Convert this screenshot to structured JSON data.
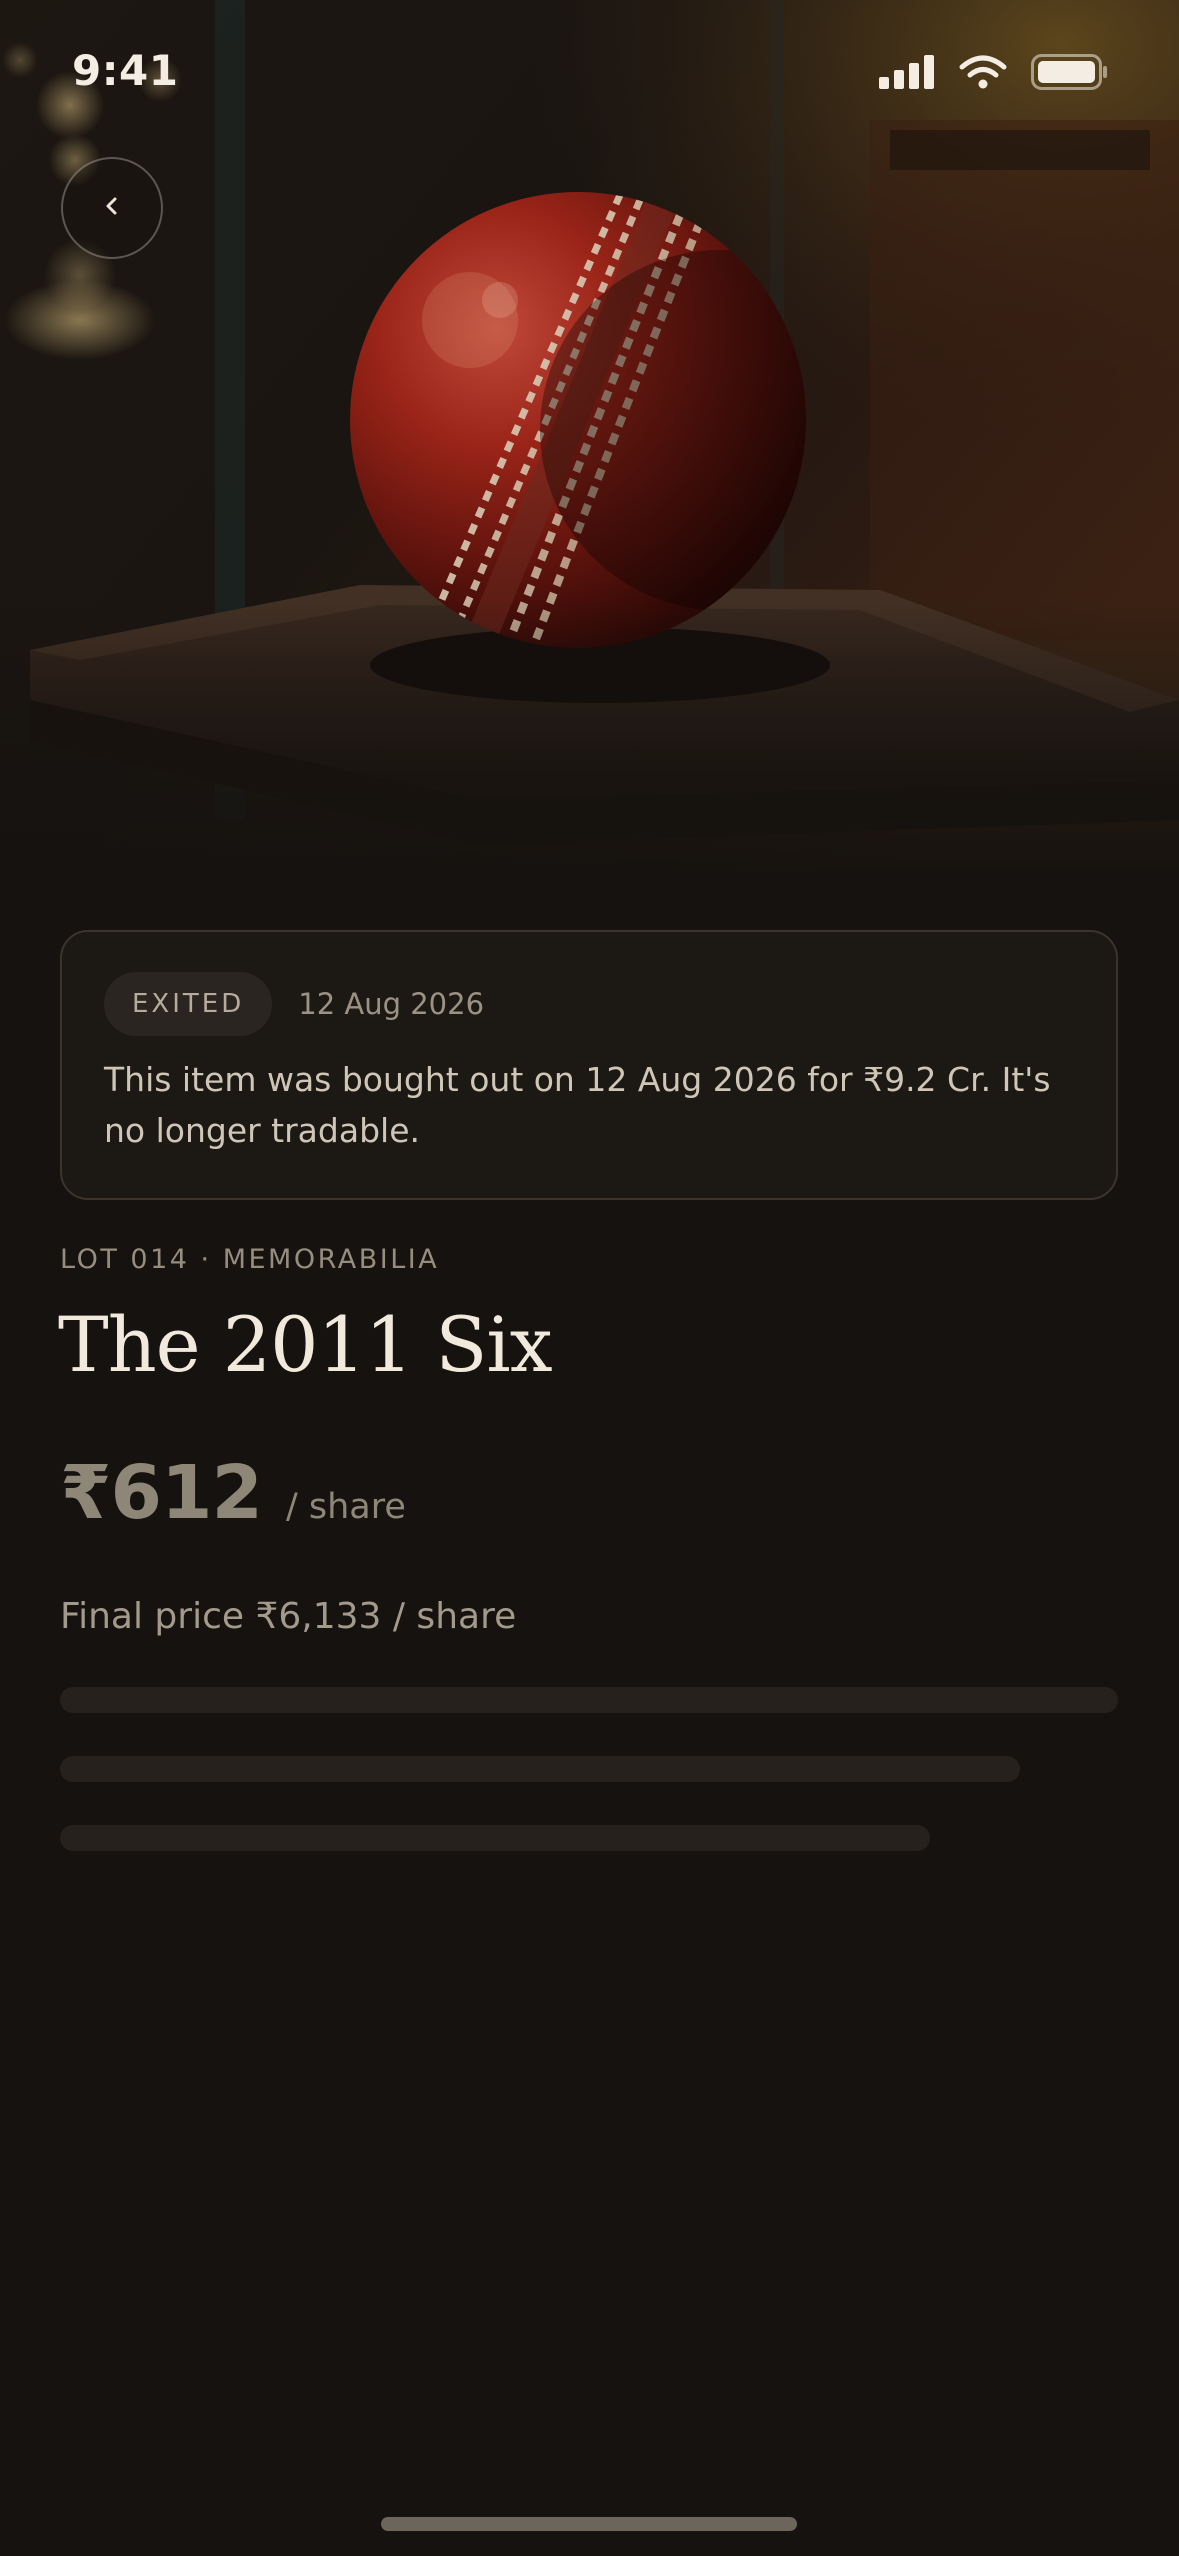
{
  "status_bar": {
    "time": "9:41",
    "icons": [
      "signal-icon",
      "wifi-icon",
      "battery-icon"
    ]
  },
  "hero": {
    "image": "cricket-ball-in-display-case",
    "back_icon": "chevron-left-icon"
  },
  "exit_notice": {
    "badge": "EXITED",
    "date": "12 Aug 2026",
    "message": "This item was bought out on 12 Aug 2026 for ₹9.2 Cr. It's no longer tradable."
  },
  "lot": {
    "label": "LOT 014 · MEMORABILIA",
    "title": "The 2011 Six",
    "price": "₹612",
    "price_unit": "/ share",
    "final_price": "Final price ₹6,133 / share"
  },
  "colors": {
    "background": "#15120f",
    "card": "#1c1915",
    "card_border": "#3a342d",
    "text_primary": "#f1e9db",
    "text_muted": "#968d7f",
    "ball_red": "#8e1f15"
  }
}
